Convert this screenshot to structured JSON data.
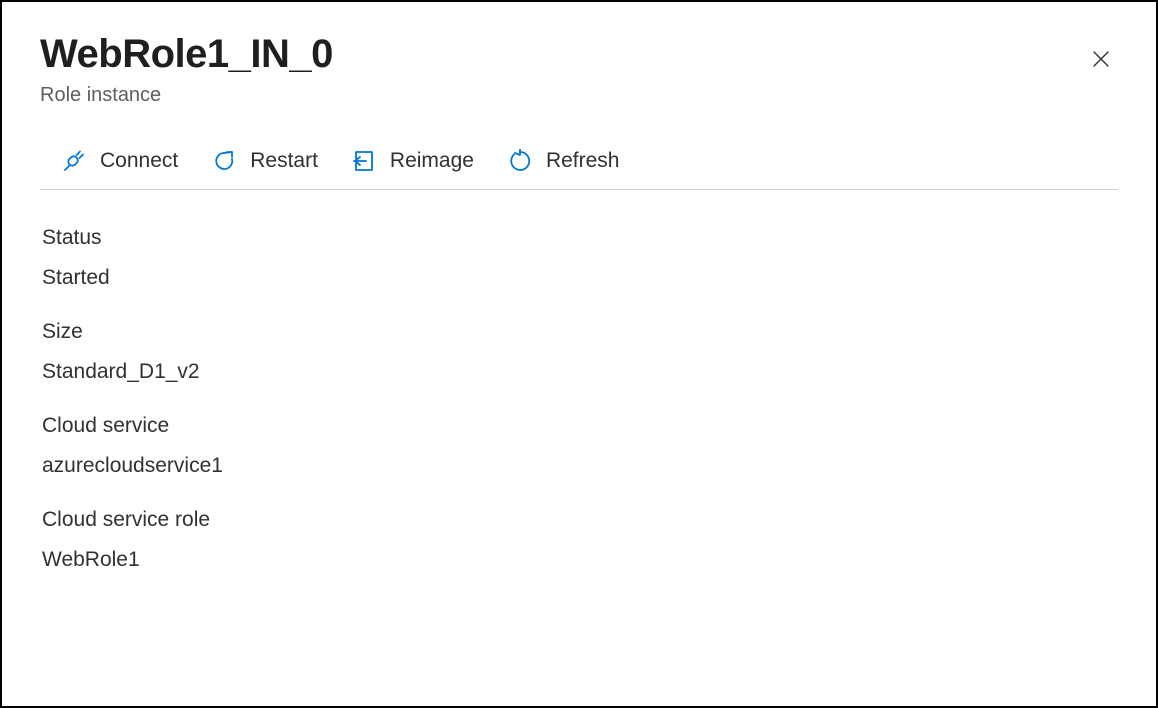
{
  "header": {
    "title": "WebRole1_IN_0",
    "subtitle": "Role instance"
  },
  "toolbar": {
    "connect": "Connect",
    "restart": "Restart",
    "reimage": "Reimage",
    "refresh": "Refresh"
  },
  "fields": {
    "status": {
      "label": "Status",
      "value": "Started"
    },
    "size": {
      "label": "Size",
      "value": "Standard_D1_v2"
    },
    "cloud_service": {
      "label": "Cloud service",
      "value": "azurecloudservice1"
    },
    "cloud_service_role": {
      "label": "Cloud service role",
      "value": "WebRole1"
    }
  }
}
